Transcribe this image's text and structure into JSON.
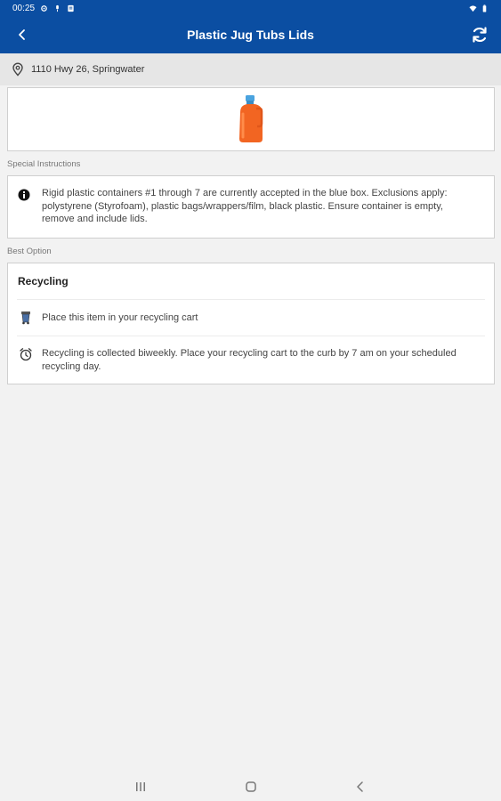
{
  "status_bar": {
    "time": "00:25"
  },
  "app_bar": {
    "title": "Plastic Jug Tubs Lids",
    "accent_color": "#0b4ea2"
  },
  "address": {
    "text": "1110 Hwy 26, Springwater"
  },
  "item_image": {
    "icon": "detergent-jug-icon"
  },
  "special_instructions": {
    "label": "Special Instructions",
    "text": "Rigid plastic containers #1 through 7 are currently accepted in the blue box. Exclusions apply: polystyrene (Styrofoam), plastic bags/wrappers/film, black plastic. Ensure container is empty, remove and include lids."
  },
  "best_option": {
    "label": "Best Option",
    "heading": "Recycling",
    "items": [
      {
        "icon": "recycling-cart-icon",
        "text": "Place this item in your recycling cart"
      },
      {
        "icon": "alarm-clock-icon",
        "text": "Recycling is collected biweekly. Place your recycling cart to the curb by 7 am on your scheduled recycling day."
      }
    ]
  }
}
